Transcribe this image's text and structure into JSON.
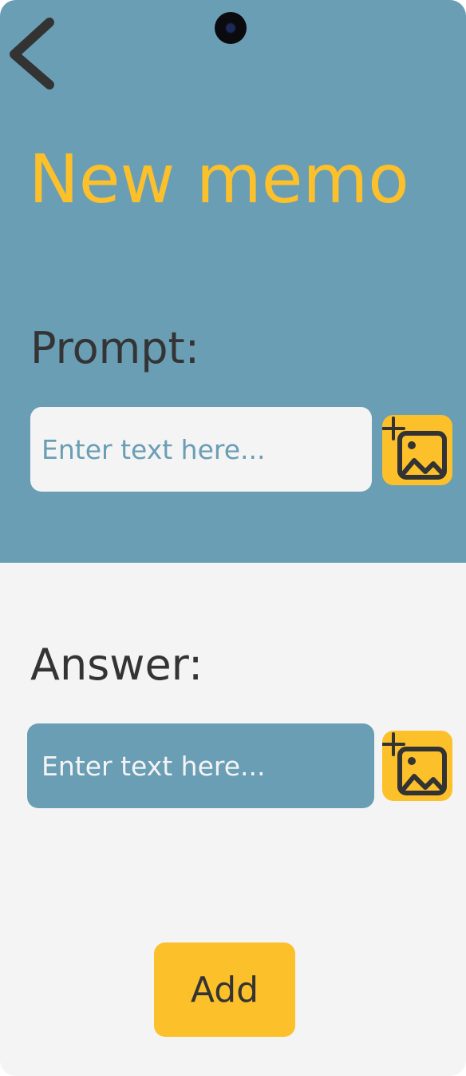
{
  "header": {
    "title": "New memo",
    "back_icon": "chevron-left-icon"
  },
  "prompt": {
    "label": "Prompt:",
    "placeholder": "Enter text here...",
    "value": "",
    "image_icon": "add-image-icon"
  },
  "answer": {
    "label": "Answer:",
    "placeholder": "Enter text here...",
    "value": "",
    "image_icon": "add-image-icon"
  },
  "actions": {
    "add_label": "Add"
  },
  "colors": {
    "primary": "#6a9eb5",
    "accent": "#fcc02a",
    "background": "#f4f4f4",
    "text": "#343434"
  }
}
